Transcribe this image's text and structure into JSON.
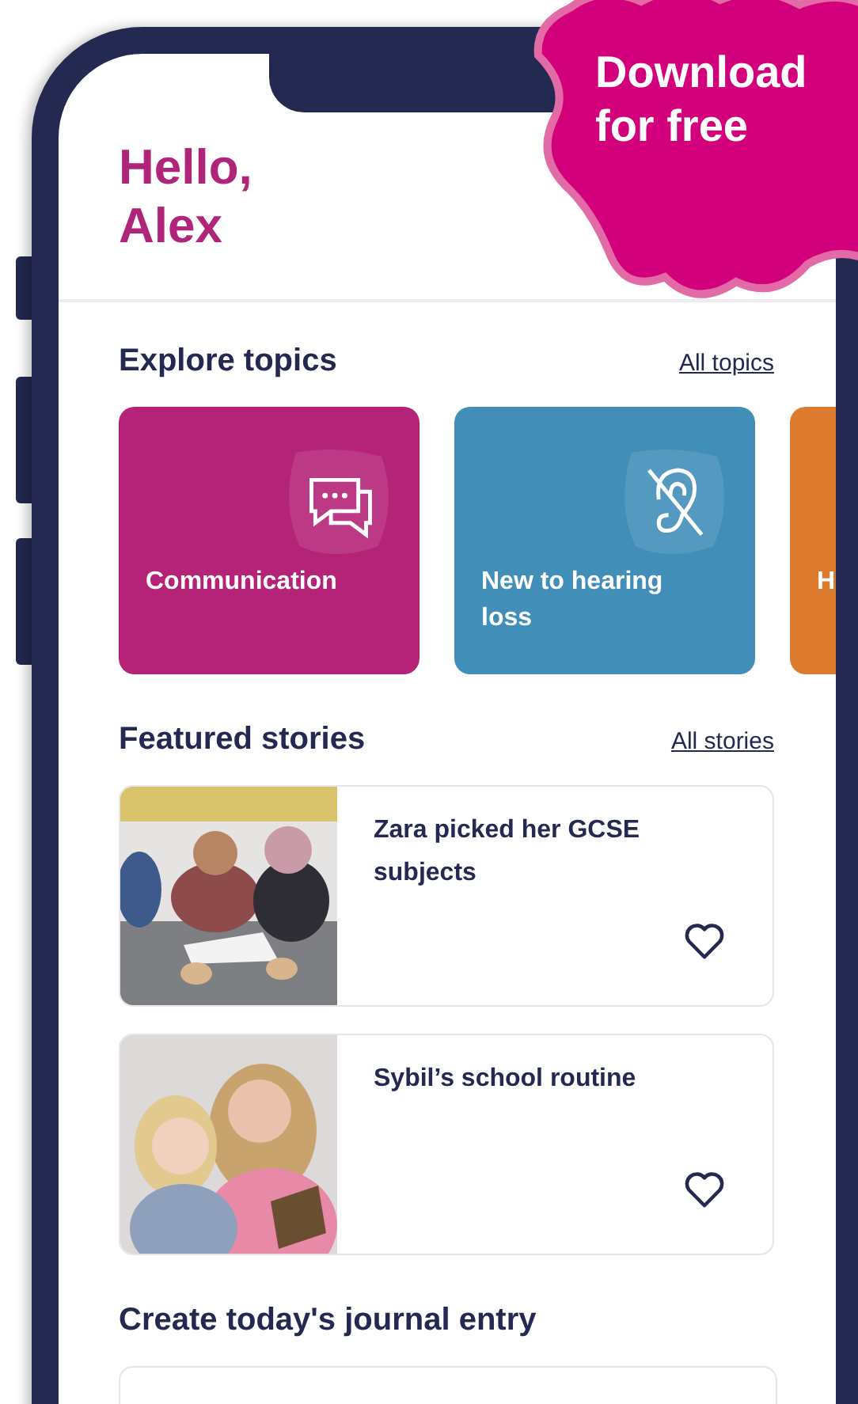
{
  "badge": {
    "lines": [
      "Download",
      "for free"
    ]
  },
  "greeting": {
    "lines": [
      "Hello,",
      "Alex"
    ]
  },
  "topics": {
    "title": "Explore topics",
    "link": "All topics",
    "items": [
      {
        "label": "Communication",
        "color": "#b42378",
        "kind": "chat"
      },
      {
        "label": "New to hearing loss",
        "color": "#418eb9",
        "kind": "ear"
      },
      {
        "label": "H",
        "color": "#dc7b2e",
        "kind": "plain"
      }
    ]
  },
  "stories": {
    "title": "Featured stories",
    "link": "All stories",
    "items": [
      {
        "title": "Zara picked her GCSE subjects",
        "favorite": false,
        "kind": "table"
      },
      {
        "title": "Sybil’s school routine",
        "favorite": false,
        "kind": "reading"
      }
    ]
  },
  "journal": {
    "title": "Create today's journal entry"
  }
}
